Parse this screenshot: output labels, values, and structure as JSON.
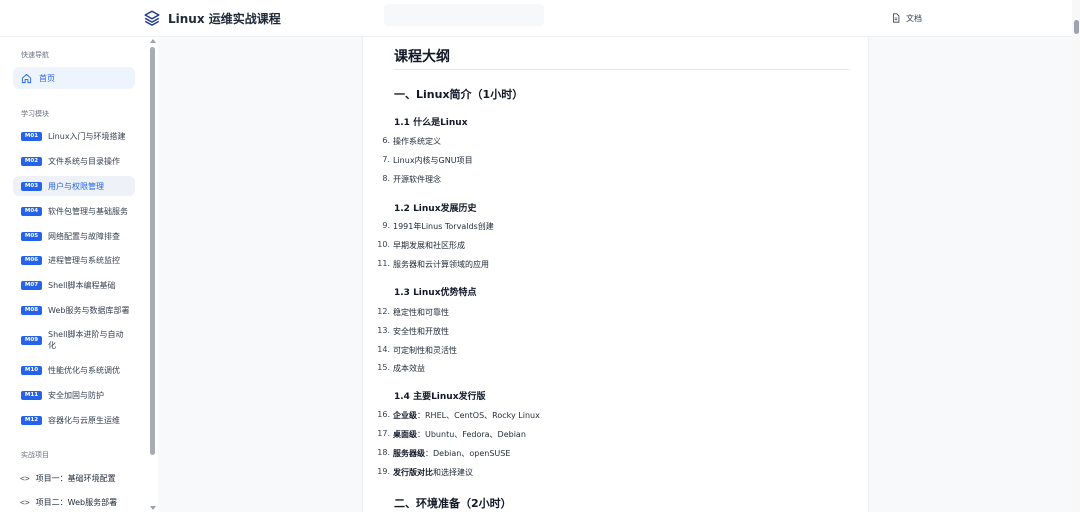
{
  "header": {
    "title": "Linux 运维实战课程",
    "docs_label": "文档"
  },
  "sidebar": {
    "quick_nav_title": "快速导航",
    "home_label": "首页",
    "modules_title": "学习模块",
    "modules": [
      {
        "code": "M01",
        "label": "Linux入门与环境搭建"
      },
      {
        "code": "M02",
        "label": "文件系统与目录操作"
      },
      {
        "code": "M03",
        "label": "用户与权限管理"
      },
      {
        "code": "M04",
        "label": "软件包管理与基础服务"
      },
      {
        "code": "M05",
        "label": "网络配置与故障排查"
      },
      {
        "code": "M06",
        "label": "进程管理与系统监控"
      },
      {
        "code": "M07",
        "label": "Shell脚本编程基础"
      },
      {
        "code": "M08",
        "label": "Web服务与数据库部署"
      },
      {
        "code": "M09",
        "label": "Shell脚本进阶与自动化"
      },
      {
        "code": "M10",
        "label": "性能优化与系统调优"
      },
      {
        "code": "M11",
        "label": "安全加固与防护"
      },
      {
        "code": "M12",
        "label": "容器化与云原生运维"
      }
    ],
    "projects_title": "实战项目",
    "projects": [
      {
        "code": "<>",
        "label": "项目一：基础环境配置"
      },
      {
        "code": "<>",
        "label": "项目二：Web服务部署"
      }
    ]
  },
  "content": {
    "title": "课程大纲",
    "section1": "一、Linux简介（1小时）",
    "sub1": "1.1 什么是Linux",
    "sub2": "1.2 Linux发展历史",
    "sub3": "1.3 Linux优势特点",
    "sub4": "1.4 主要Linux发行版",
    "section2": "二、环境准备（2小时）",
    "items": [
      {
        "n": "6.",
        "text": "操作系统定义"
      },
      {
        "n": "7.",
        "text": "Linux内核与GNU项目"
      },
      {
        "n": "8.",
        "text": "开源软件理念"
      },
      {
        "n": "9.",
        "text": "1991年Linus Torvalds创建"
      },
      {
        "n": "10.",
        "text": "早期发展和社区形成"
      },
      {
        "n": "11.",
        "text": "服务器和云计算领域的应用"
      },
      {
        "n": "12.",
        "text": "稳定性和可靠性"
      },
      {
        "n": "13.",
        "text": "安全性和开放性"
      },
      {
        "n": "14.",
        "text": "可定制性和灵活性"
      },
      {
        "n": "15.",
        "text": "成本效益"
      },
      {
        "n": "16.",
        "bold": "企业级",
        "text": "：RHEL、CentOS、Rocky Linux"
      },
      {
        "n": "17.",
        "bold": "桌面级",
        "text": "：Ubuntu、Fedora、Debian"
      },
      {
        "n": "18.",
        "bold": "服务器级",
        "text": "：Debian、openSUSE"
      },
      {
        "n": "19.",
        "bold": "发行版对比",
        "text": "和选择建议"
      }
    ]
  },
  "colors": {
    "accent": "#2563eb",
    "active_bg": "#eef4fd",
    "page_bg": "#f8f9fb"
  },
  "icons": [
    "layers-logo-icon",
    "document-icon",
    "home-icon",
    "code-icon"
  ]
}
